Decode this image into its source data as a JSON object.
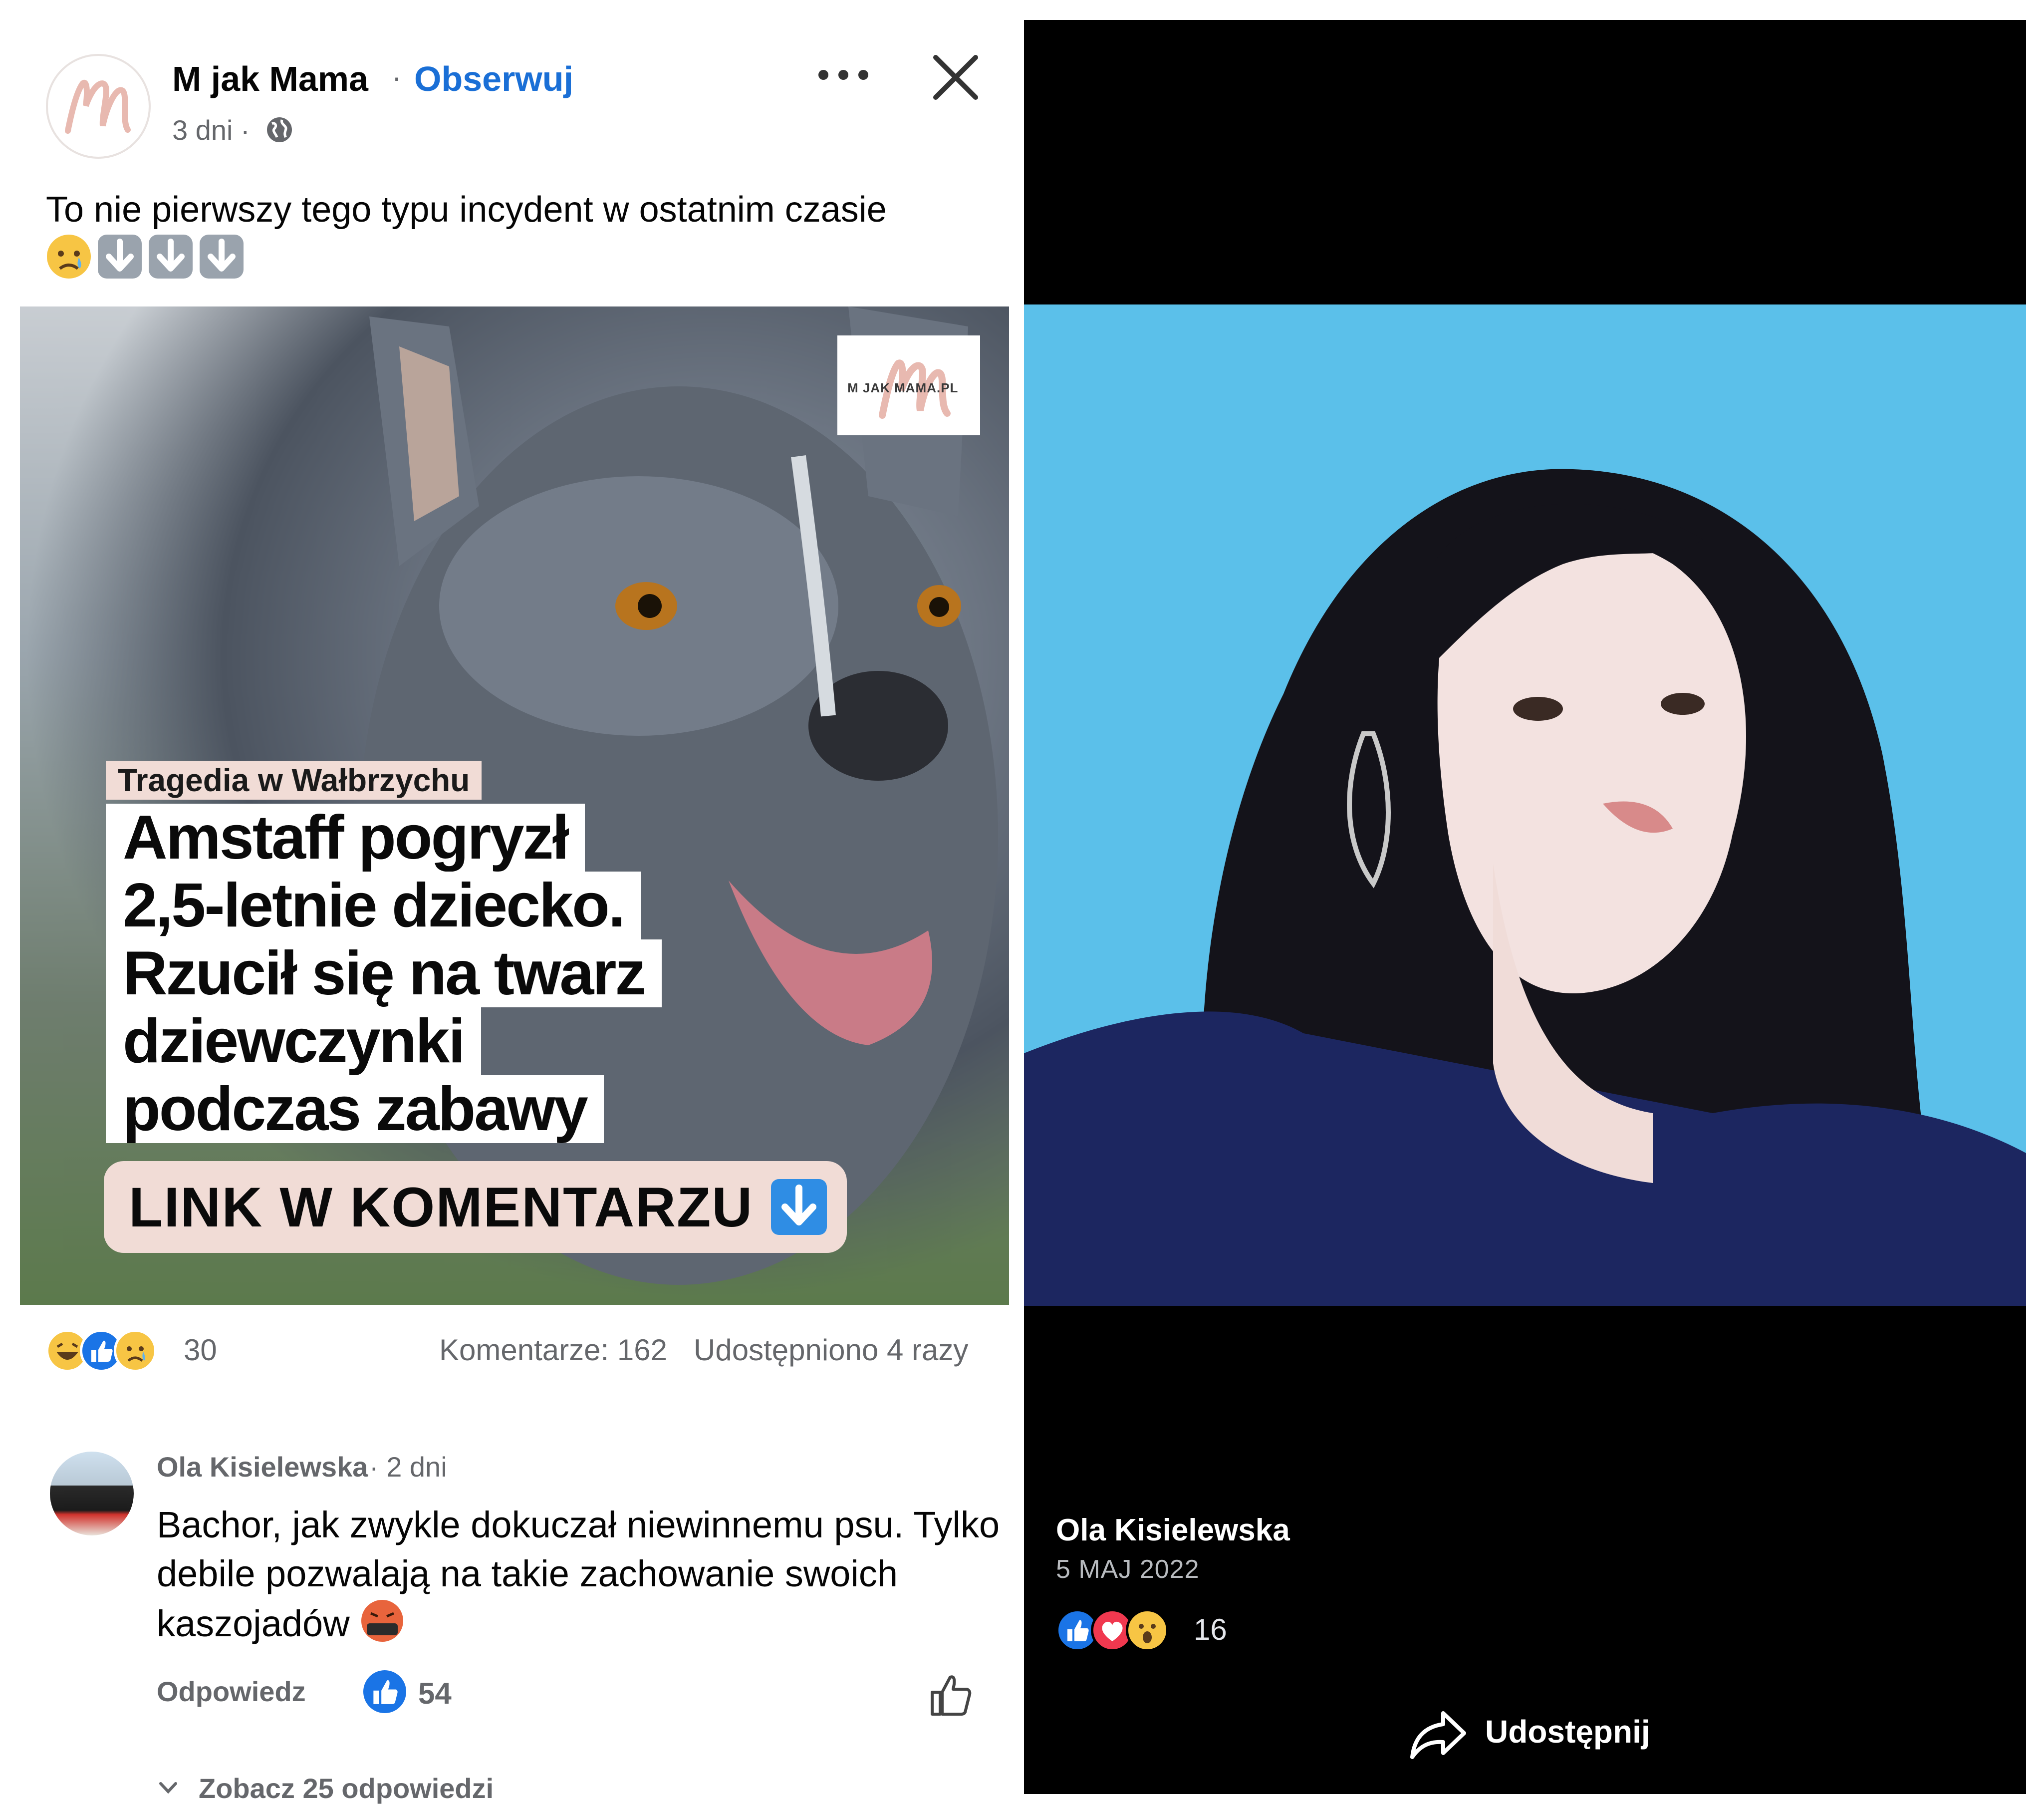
{
  "post": {
    "page_name": "M jak Mama",
    "separator": "·",
    "follow_label": "Obserwuj",
    "time": "3 dni ·",
    "visibility_icon": "globe-icon",
    "text": "To nie pierwszy tego typu incydent w ostatnim czasie",
    "text_emojis": [
      "crying-face-emoji",
      "down-arrow-emoji",
      "down-arrow-emoji",
      "down-arrow-emoji"
    ],
    "image": {
      "brand_text": "M JAK MAMA.PL",
      "tag": "Tragedia w Wałbrzychu",
      "headline": [
        "Amstaff pogryzł",
        "2,5-letnie dziecko.",
        "Rzucił się na twarz",
        "dziewczynki",
        "podczas zabawy"
      ],
      "cta": "LINK W KOMENTARZU"
    },
    "reactions": {
      "icons": [
        "haha",
        "like",
        "sad"
      ],
      "count": "30",
      "comments": "Komentarze: 162",
      "shares": "Udostępniono 4 razy"
    }
  },
  "comment": {
    "author": "Ola Kisielewska",
    "time": "· 2 dni",
    "text": "Bachor, jak zwykle dokuczał niewinnemu psu. Tylko debile pozwalają na takie zachowanie swoich kaszojadów",
    "emoji": "swearing-face-emoji",
    "reply_label": "Odpowiedz",
    "likes": "54",
    "view_replies": "Zobacz 25 odpowiedzi"
  },
  "viewer": {
    "author": "Ola Kisielewska",
    "date": "5 MAJ 2022",
    "reactions": [
      "like",
      "love",
      "wow"
    ],
    "reaction_count": "16",
    "share_label": "Udostępnij"
  },
  "colors": {
    "brand_blue": "#1a6fd6",
    "like_blue": "#1a74e6",
    "pink_pill": "#f1dcd6",
    "photo_bg": "#5bc0ea"
  }
}
